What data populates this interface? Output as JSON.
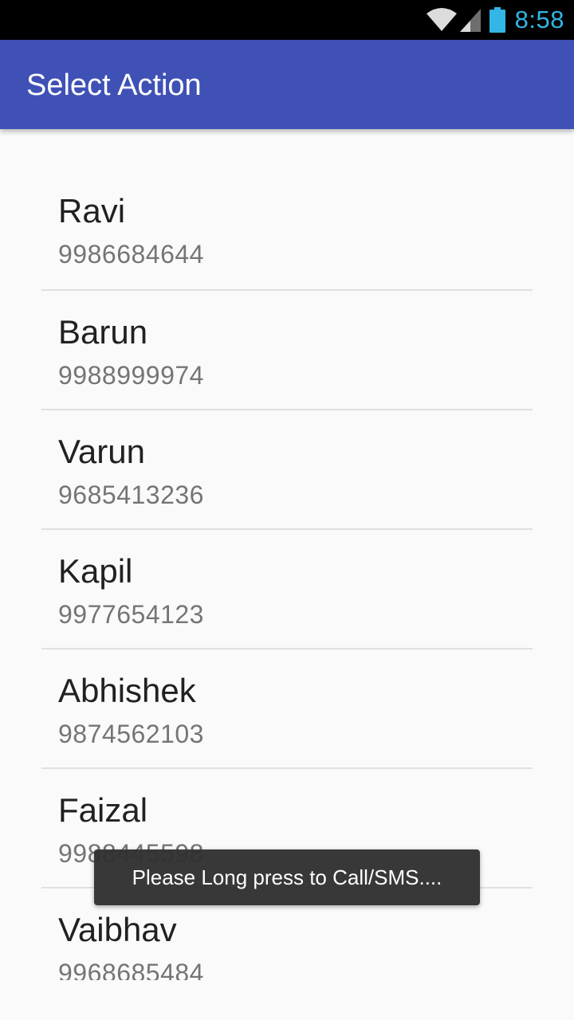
{
  "status_bar": {
    "time": "8:58",
    "icons": [
      "wifi-icon",
      "cell-signal-icon",
      "battery-icon"
    ],
    "time_color": "#33b5e5"
  },
  "app_bar": {
    "title": "Select Action",
    "color": "#3f51b5"
  },
  "contacts": [
    {
      "name": "Ravi",
      "phone": "9986684644"
    },
    {
      "name": "Barun",
      "phone": "9988999974"
    },
    {
      "name": "Varun",
      "phone": "9685413236"
    },
    {
      "name": "Kapil",
      "phone": "9977654123"
    },
    {
      "name": "Abhishek",
      "phone": "9874562103"
    },
    {
      "name": "Faizal",
      "phone": "9988445598"
    },
    {
      "name": "Vaibhav",
      "phone": "9968685484"
    }
  ],
  "toast": {
    "message": "Please Long press to Call/SMS...."
  }
}
